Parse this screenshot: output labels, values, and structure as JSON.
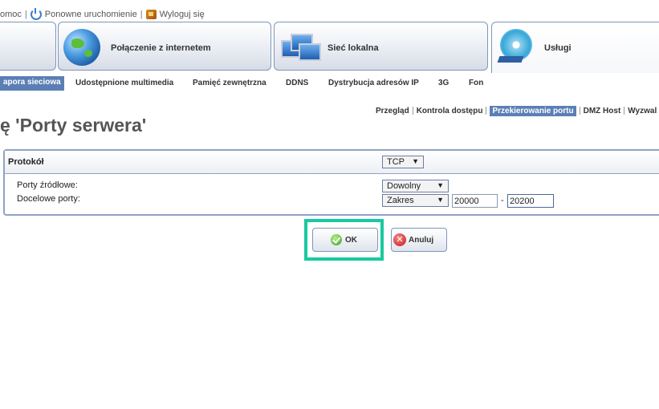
{
  "top_links": {
    "help": "omoc",
    "restart": "Ponowne uruchomienie",
    "logout": "Wyloguj się"
  },
  "main_tabs": [
    {
      "label": ""
    },
    {
      "label": "Połączenie z internetem"
    },
    {
      "label": "Sieć lokalna"
    },
    {
      "label": "Usługi"
    }
  ],
  "sub_nav": [
    "apora sieciowa",
    "Udostępnione multimedia",
    "Pamięć zewnętrzna",
    "DDNS",
    "Dystrybucja adresów IP",
    "3G",
    "Fon"
  ],
  "tert_nav": [
    "Przegląd",
    "Kontrola dostępu",
    "Przekierowanie portu",
    "DMZ Host",
    "Wyzwal"
  ],
  "page_title": "ę 'Porty serwera'",
  "form": {
    "protocol_label": "Protokół",
    "protocol_value": "TCP",
    "source_ports_label": "Porty źródłowe:",
    "source_ports_value": "Dowolny",
    "dest_ports_label": "Docelowe porty:",
    "dest_ports_value": "Zakres",
    "range_from": "20000",
    "range_sep": "-",
    "range_to": "20200"
  },
  "buttons": {
    "ok": "OK",
    "cancel": "Anuluj"
  },
  "colors": {
    "highlight": "#19c9a0",
    "active_tab": "#5b7fb5"
  }
}
